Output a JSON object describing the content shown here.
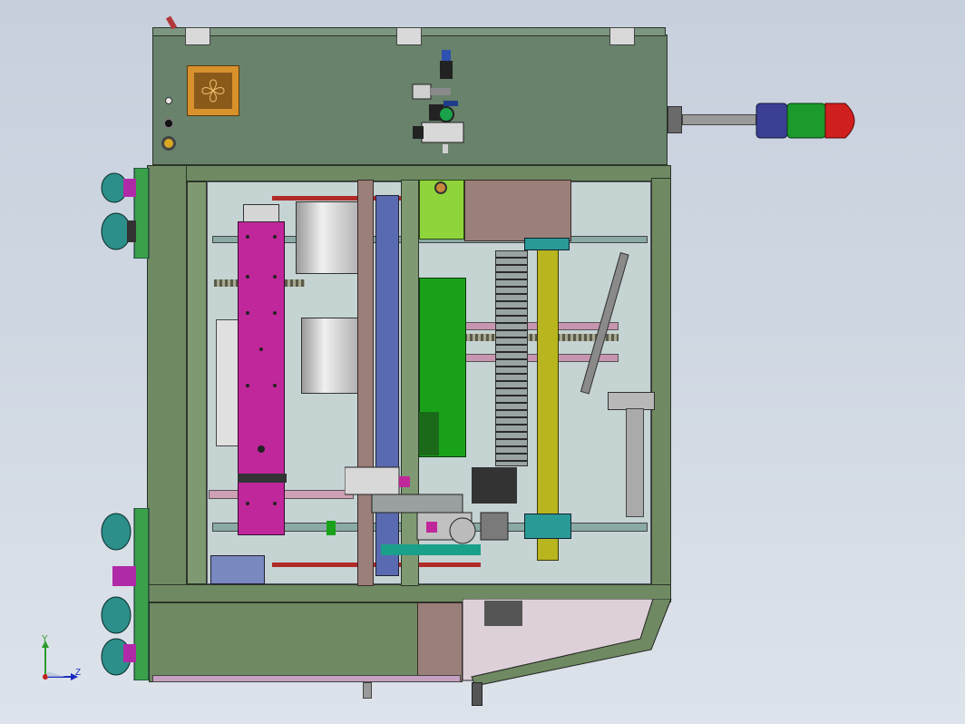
{
  "viewport": {
    "background_top": "#c7d0dd",
    "background_bottom": "#dde3ea"
  },
  "model": {
    "colors": {
      "frame": "#6f8a62",
      "panel": "#68826b",
      "magenta_carriage": "#c0279a",
      "green_block": "#1aa11a",
      "lime_block": "#8fd43a",
      "yellow_rail": "#b8b51e",
      "steel_cylinder": "#cfcfcf",
      "teal_part": "#2a9a96",
      "beacon_red": "#d01f1f",
      "beacon_green": "#1c9a2c",
      "beacon_blue": "#3a3f94",
      "caster_teal": "#2c8f8a",
      "caster_magenta": "#b02aa8",
      "fan_orange": "#d9912c"
    },
    "icons": [
      "fan-grille-icon",
      "pressure-gauge-icon",
      "signal-beacon-icon",
      "caster-wheel-icon",
      "hinge-icon"
    ]
  },
  "triad": {
    "y_label": "Y",
    "z_label": "Z",
    "colors": {
      "y": "#2a9a2a",
      "z": "#1a2cbf",
      "x": "#c21f1f"
    }
  }
}
